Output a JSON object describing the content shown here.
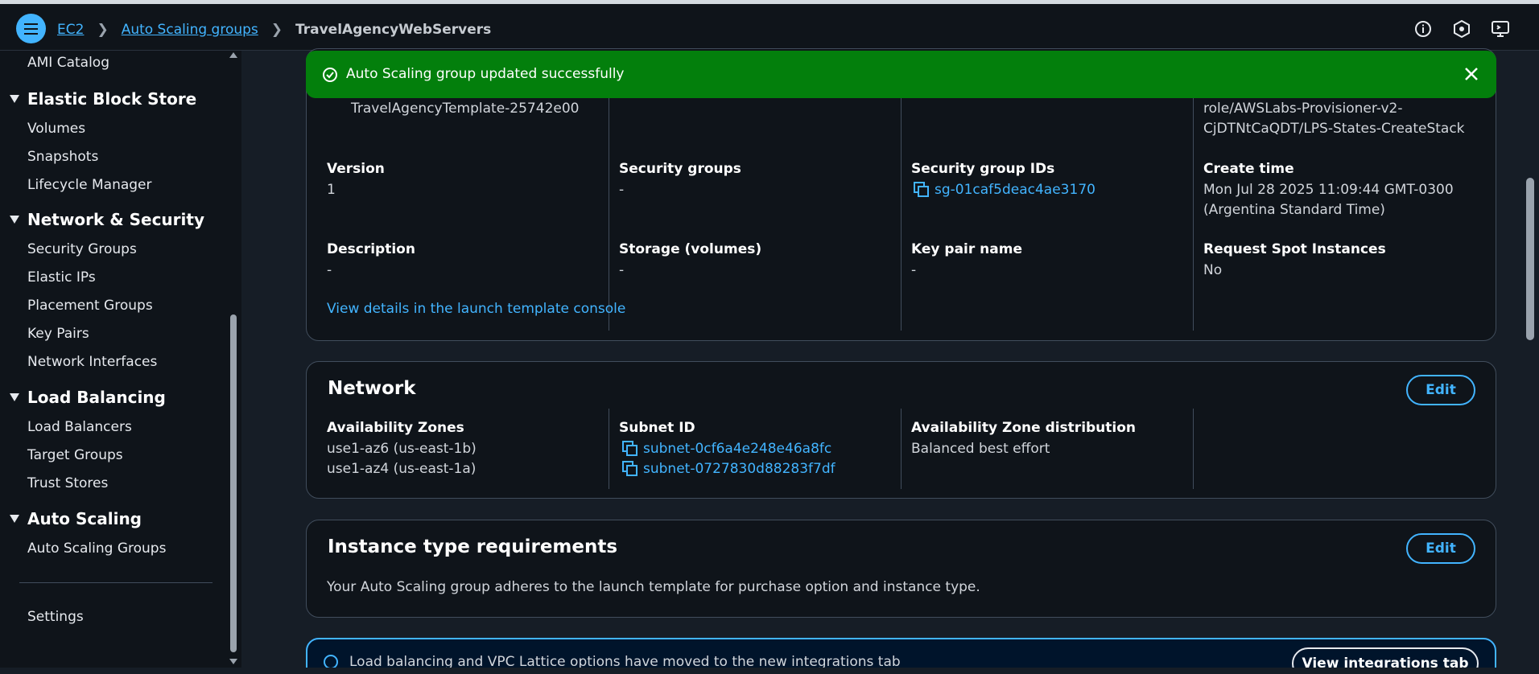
{
  "breadcrumb": {
    "items": [
      "EC2",
      "Auto Scaling groups"
    ],
    "current": "TravelAgencyWebServers"
  },
  "top_icons": [
    "info-icon",
    "settings-hex-icon",
    "feedback-icon"
  ],
  "sidebar": {
    "ami": "AMI Catalog",
    "ebs": {
      "title": "Elastic Block Store",
      "items": [
        "Volumes",
        "Snapshots",
        "Lifecycle Manager"
      ]
    },
    "net": {
      "title": "Network & Security",
      "items": [
        "Security Groups",
        "Elastic IPs",
        "Placement Groups",
        "Key Pairs",
        "Network Interfaces"
      ]
    },
    "lb": {
      "title": "Load Balancing",
      "items": [
        "Load Balancers",
        "Target Groups",
        "Trust Stores"
      ]
    },
    "as": {
      "title": "Auto Scaling",
      "items": [
        "Auto Scaling Groups"
      ]
    },
    "settings": "Settings"
  },
  "flash": {
    "message": "Auto Scaling group updated successfully"
  },
  "launch_template": {
    "template_name": "TravelAgencyTemplate-25742e00",
    "role_line1": "role/AWSLabs-Provisioner-v2-",
    "role_line2": "CjDTNtCaQDT/LPS-States-CreateStack",
    "version_label": "Version",
    "version_value": "1",
    "sg_label": "Security groups",
    "sg_value": "-",
    "sgid_label": "Security group IDs",
    "sgid_value": "sg-01caf5deac4ae3170",
    "create_label": "Create time",
    "create_line1": "Mon Jul 28 2025 11:09:44 GMT-0300",
    "create_line2": "(Argentina Standard Time)",
    "desc_label": "Description",
    "desc_value": "-",
    "storage_label": "Storage (volumes)",
    "storage_value": "-",
    "keypair_label": "Key pair name",
    "keypair_value": "-",
    "spot_label": "Request Spot Instances",
    "spot_value": "No",
    "details_link": "View details in the launch template console"
  },
  "network": {
    "title": "Network",
    "edit": "Edit",
    "az_label": "Availability Zones",
    "az_values": [
      "use1-az6 (us-east-1b)",
      "use1-az4 (us-east-1a)"
    ],
    "subnet_label": "Subnet ID",
    "subnets": [
      "subnet-0cf6a4e248e46a8fc",
      "subnet-0727830d88283f7df"
    ],
    "dist_label": "Availability Zone distribution",
    "dist_value": "Balanced best effort"
  },
  "instance_req": {
    "title": "Instance type requirements",
    "edit": "Edit",
    "text": "Your Auto Scaling group adheres to the launch template for purchase option and instance type."
  },
  "banner": {
    "text": "Load balancing and VPC Lattice options have moved to the new integrations tab",
    "button": "View integrations tab"
  }
}
